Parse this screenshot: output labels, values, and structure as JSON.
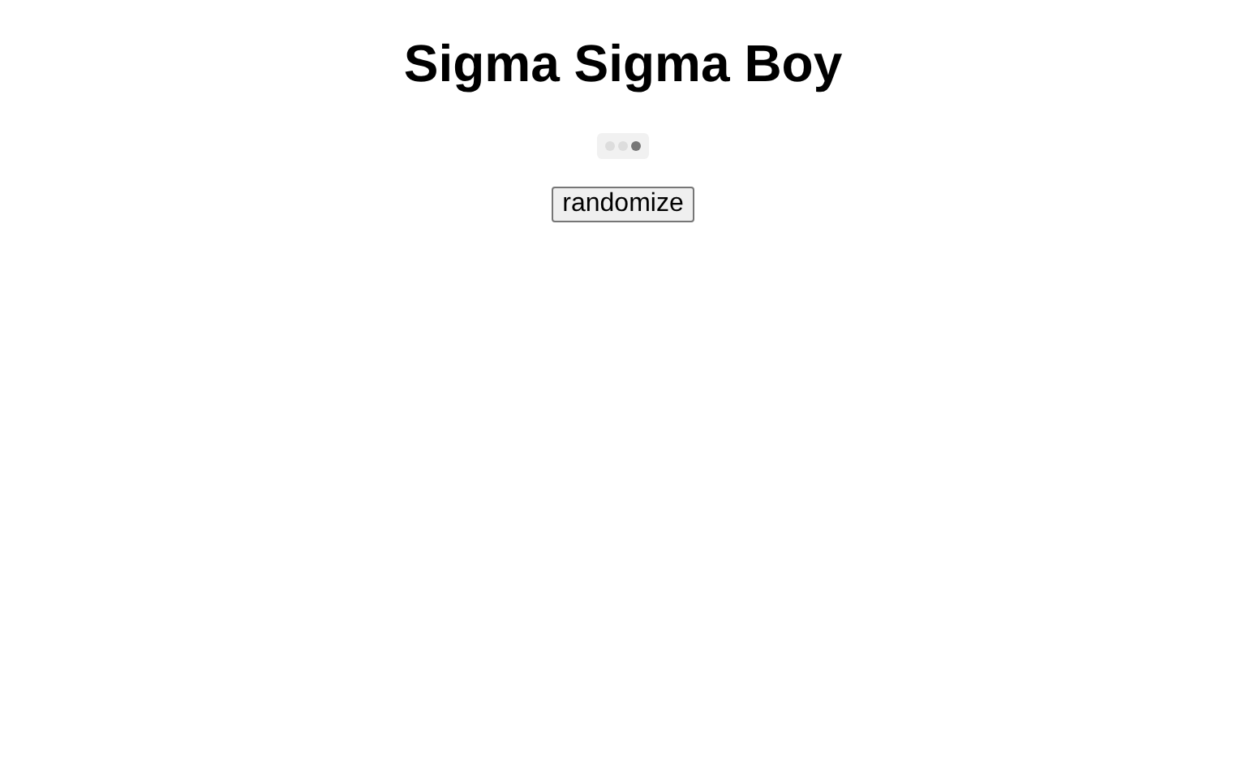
{
  "title": "Sigma Sigma Boy",
  "loader": {
    "dots": [
      {
        "selected": false
      },
      {
        "selected": false
      },
      {
        "selected": true
      }
    ]
  },
  "button": {
    "label": "randomize"
  }
}
